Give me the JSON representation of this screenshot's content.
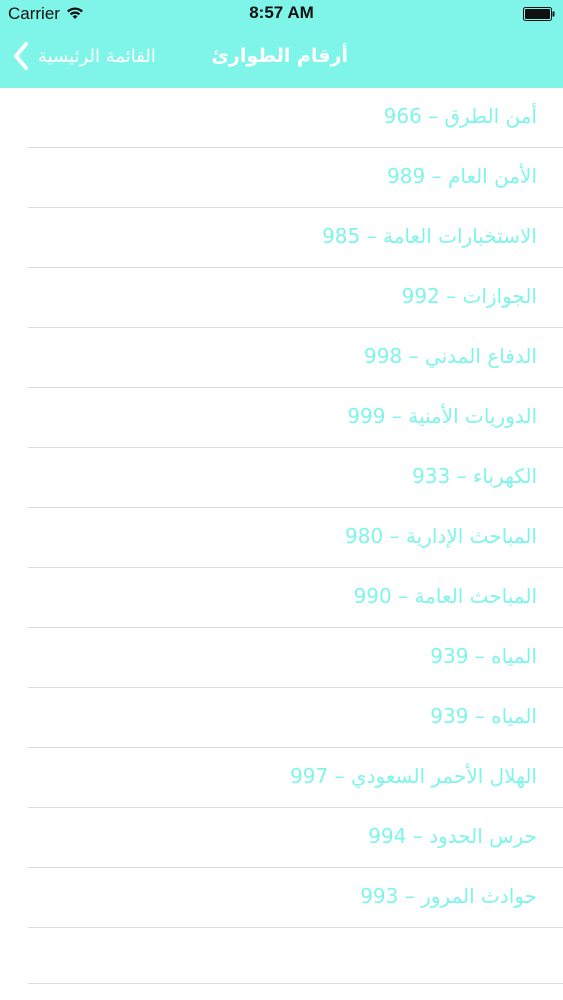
{
  "status_bar": {
    "carrier": "Carrier",
    "time": "8:57 AM"
  },
  "nav": {
    "title": "أرقام الطوارئ",
    "back_label": "القائمة الرئيسية"
  },
  "colors": {
    "accent": "#7ff5ea",
    "separator": "#dcdcdc"
  },
  "items": [
    {
      "label": "أمن الطرق – 966"
    },
    {
      "label": "الأمن العام – 989"
    },
    {
      "label": "الاستخبارات العامة – 985"
    },
    {
      "label": "الجوازات – 992"
    },
    {
      "label": "الدفاع المدني – 998"
    },
    {
      "label": "الدوريات الأمنية – 999"
    },
    {
      "label": "الكهرباء – 933"
    },
    {
      "label": "المباحث الإدارية – 980"
    },
    {
      "label": "المباحث العامة – 990"
    },
    {
      "label": "المياه – 939"
    },
    {
      "label": "المياه – 939"
    },
    {
      "label": "الهلال الأحمر السعودي – 997"
    },
    {
      "label": "حرس الحدود – 994"
    },
    {
      "label": "حوادث المرور – 993"
    }
  ]
}
